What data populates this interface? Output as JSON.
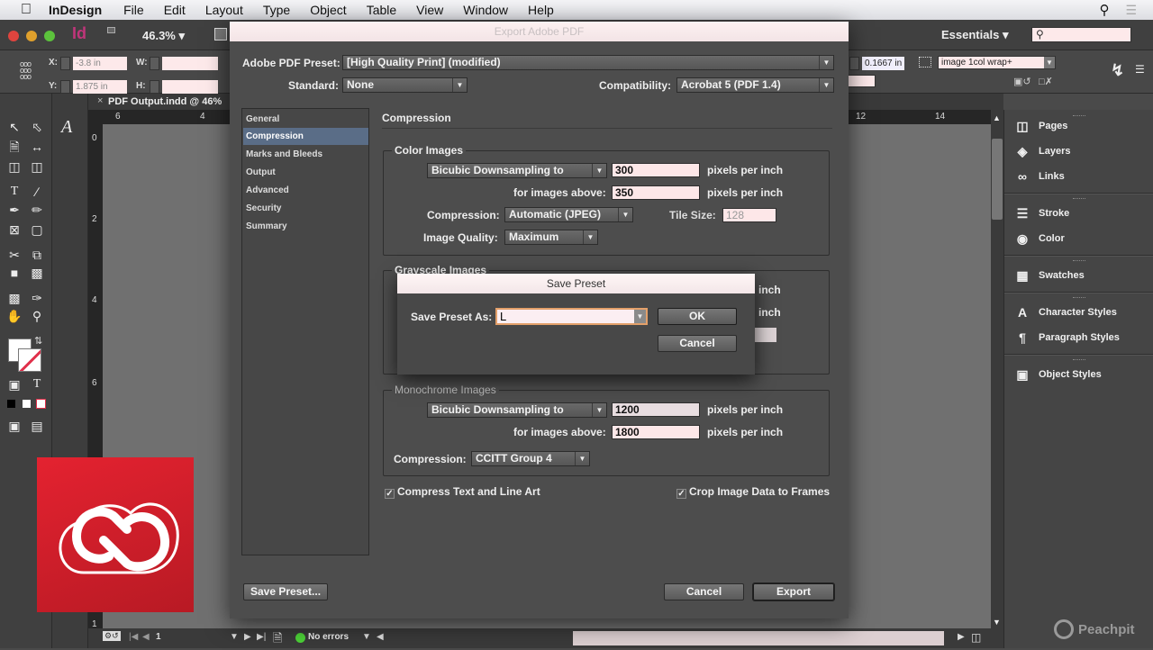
{
  "menubar": {
    "app": "InDesign",
    "items": [
      "File",
      "Edit",
      "Layout",
      "Type",
      "Object",
      "Table",
      "View",
      "Window",
      "Help"
    ]
  },
  "appbar": {
    "zoom": "46.3%",
    "workspace": "Essentials",
    "search_placeholder": ""
  },
  "control": {
    "x_label": "X:",
    "x_value": "-3.8 in",
    "y_label": "Y:",
    "y_value": "1.875 in",
    "w_label": "W:",
    "w_value": "",
    "h_label": "H:",
    "h_value": "",
    "offset_value": "0.1667 in",
    "object_style": "image 1col wrap+"
  },
  "document": {
    "tab_title": "PDF Output.indd @ 46%",
    "ruler_h": [
      "6",
      "4",
      "12",
      "14"
    ],
    "ruler_v": [
      "0",
      "2",
      "4",
      "6",
      "1"
    ]
  },
  "status": {
    "page": "1",
    "preflight": "No errors"
  },
  "panels": {
    "items": [
      "Pages",
      "Layers",
      "Links",
      "Stroke",
      "Color",
      "Swatches",
      "Character Styles",
      "Paragraph Styles",
      "Object Styles"
    ]
  },
  "export_dialog": {
    "title": "Export Adobe PDF",
    "preset_label": "Adobe PDF Preset:",
    "preset_value": "[High Quality Print] (modified)",
    "standard_label": "Standard:",
    "standard_value": "None",
    "compat_label": "Compatibility:",
    "compat_value": "Acrobat 5 (PDF 1.4)",
    "categories": [
      "General",
      "Compression",
      "Marks and Bleeds",
      "Output",
      "Advanced",
      "Security",
      "Summary"
    ],
    "selected_category": "Compression",
    "section_title": "Compression",
    "color": {
      "title": "Color Images",
      "sampling": "Bicubic Downsampling to",
      "ppi": "300",
      "ppi_unit": "pixels per inch",
      "above_label": "for images above:",
      "above": "350",
      "above_unit": "pixels per inch",
      "compression_label": "Compression:",
      "compression": "Automatic (JPEG)",
      "tile_label": "Tile Size:",
      "tile": "128",
      "quality_label": "Image Quality:",
      "quality": "Maximum"
    },
    "gray": {
      "title": "Grayscale Images",
      "unit1": "inch",
      "unit2": "inch"
    },
    "mono": {
      "title": "Monochrome Images",
      "sampling": "Bicubic Downsampling to",
      "ppi": "1200",
      "ppi_unit": "pixels per inch",
      "above_label": "for images above:",
      "above": "1800",
      "above_unit": "pixels per inch",
      "compression_label": "Compression:",
      "compression": "CCITT Group 4"
    },
    "compress_text": "Compress Text and Line Art",
    "crop_image": "Crop Image Data to Frames",
    "save_preset_btn": "Save Preset...",
    "cancel_btn": "Cancel",
    "export_btn": "Export"
  },
  "save_dialog": {
    "title": "Save Preset",
    "label": "Save Preset As:",
    "value": "L",
    "ok": "OK",
    "cancel": "Cancel"
  },
  "watermark": "Peachpit",
  "colors": {
    "accent_selected": "#5a6d87",
    "field_bg": "#fde7e8",
    "cc_red": "#da1f2b",
    "status_ok": "#4cd137"
  }
}
